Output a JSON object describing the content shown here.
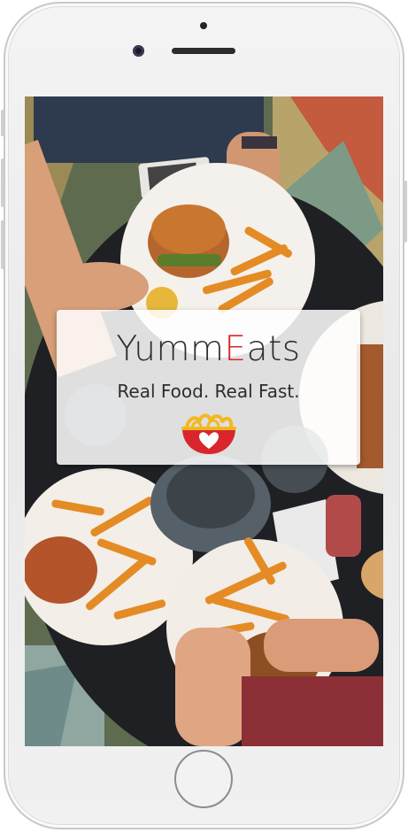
{
  "device": {
    "model_hint": "smartphone-mockup"
  },
  "splash": {
    "brand_part1": "Yumm",
    "brand_accent": "E",
    "brand_part2": "ats",
    "tagline": "Real Food. Real Fast.",
    "logo_icon": "noodle-bowl-heart-icon",
    "background_description": "overhead-restaurant-table-photo"
  },
  "colors": {
    "accent": "#d8262c",
    "logo_yellow": "#f2b81e",
    "text": "#2d2d2d"
  }
}
